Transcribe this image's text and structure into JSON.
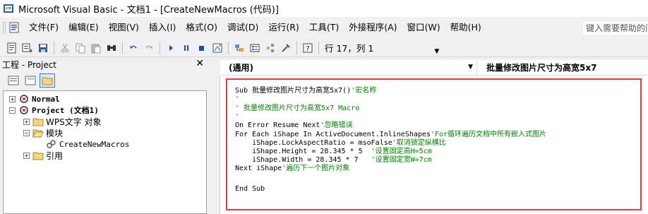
{
  "window": {
    "title": "Microsoft Visual Basic - 文档1 - [CreateNewMacros (代码)]"
  },
  "menubar": {
    "items": [
      "文件(F)",
      "编辑(E)",
      "视图(V)",
      "插入(I)",
      "格式(O)",
      "调试(D)",
      "运行(R)",
      "工具(T)",
      "外接程序(A)",
      "窗口(W)",
      "帮助(H)"
    ],
    "help_placeholder": "键入需要帮助的问"
  },
  "toolbar": {
    "status": "行 17，列 1"
  },
  "project": {
    "title": "工程 - Project",
    "tree": {
      "normal": "Normal",
      "project": "Project (文档1)",
      "wps_objects": "WPS文字 对象",
      "modules": "模块",
      "module_item": "CreateNewMacros",
      "references": "引用"
    }
  },
  "code": {
    "object_combo": "(通用)",
    "proc_combo": "批量修改图片尺寸为高宽5x7",
    "lines": [
      {
        "code": "Sub 批量修改图片尺寸为高宽5x7()",
        "comment": "'宏名称"
      },
      {
        "code": "",
        "comment": "'"
      },
      {
        "code": "",
        "comment": "' 批量修改图片尺寸为高宽5x7 Macro"
      },
      {
        "code": "",
        "comment": "'"
      },
      {
        "code": "On Error Resume Next",
        "comment": "'忽略错误"
      },
      {
        "code": "For Each iShape In ActiveDocument.InlineShapes",
        "comment": "'For循环遍历文档中所有嵌入式图片"
      },
      {
        "code": "    iShape.LockAspectRatio = msoFalse",
        "comment": "'取消锁定纵横比"
      },
      {
        "code": "    iShape.Height = 28.345 * 5  ",
        "comment": "'设置固定高H=5cm"
      },
      {
        "code": "    iShape.Width = 28.345 * 7   ",
        "comment": "'设置固定宽W=7cm"
      },
      {
        "code": "Next iShape",
        "comment": "'遍历下一个图片对象"
      },
      {
        "code": "",
        "comment": ""
      },
      {
        "code": "End Sub",
        "comment": ""
      }
    ]
  },
  "colors": {
    "highlight_border": "#e23b3b",
    "comment": "#008000",
    "keyword": "#000080"
  }
}
